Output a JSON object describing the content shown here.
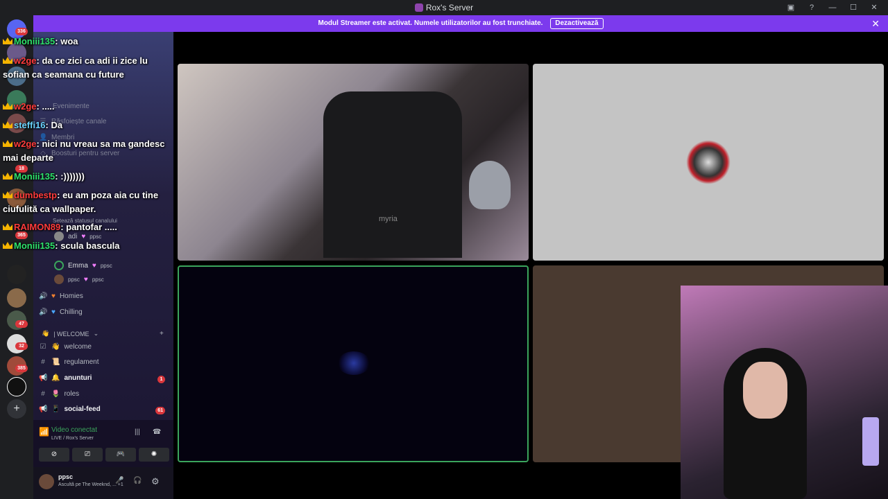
{
  "window": {
    "title": "Rox's Server"
  },
  "banner": {
    "text": "Modul Streamer este activat. Numele utilizatorilor au fost trunchiate.",
    "button": "Dezactivează"
  },
  "guild_badges": [
    "336",
    "18",
    "365",
    "47",
    "32",
    "385"
  ],
  "sidebar": {
    "menu": [
      "Evenimente",
      "Răsfoiește canale",
      "Membri",
      "Boosturi pentru server"
    ],
    "status_hint": "Setează statusul canalului",
    "voice_users": [
      {
        "name": "adi",
        "tag": "ppsc"
      },
      {
        "name": "Emma",
        "tag": "ppsc"
      },
      {
        "name": "ppsc",
        "tag": "ppsc"
      }
    ],
    "voice_channels": [
      "Homies",
      "Chilling"
    ],
    "category": "| WELCOME",
    "channels": [
      {
        "label": "welcome",
        "bold": false
      },
      {
        "label": "regulament",
        "bold": false
      },
      {
        "label": "anunturi",
        "bold": true,
        "badge": "1"
      },
      {
        "label": "roles",
        "bold": false
      },
      {
        "label": "social-feed",
        "bold": true,
        "badge": "61"
      }
    ]
  },
  "voice_status": {
    "title": "Video conectat",
    "sub": "LIVE / Rox's Server"
  },
  "user": {
    "name": "ppsc",
    "activity": "Ascultă pe The Weeknd, ...",
    "extra": "+1"
  },
  "chat": [
    {
      "user": "Moniii135",
      "text": "woa"
    },
    {
      "user": "w2ge",
      "text": "da ce zici ca adi ii zice lu sofian ca seamana cu future"
    },
    {
      "user": "w2ge",
      "text": "....."
    },
    {
      "user": "steffi16",
      "text": "Da"
    },
    {
      "user": "w2ge",
      "text": "nici nu vreau sa ma gandesc mai departe"
    },
    {
      "user": "Moniii135",
      "text": ":)))))))"
    },
    {
      "user": "dumbestp",
      "text": "eu am poza aia cu tine ciufulită ca wallpaper."
    },
    {
      "user": "RAIMON89",
      "text": "pantofar ....."
    },
    {
      "user": "Moniii135",
      "text": "sculа bascula"
    }
  ],
  "video": {
    "chair_brand": "myria"
  },
  "colors": {
    "accent": "#7c3aed",
    "speaking": "#3ba55c",
    "sidebar_top": "#3a3f73"
  }
}
